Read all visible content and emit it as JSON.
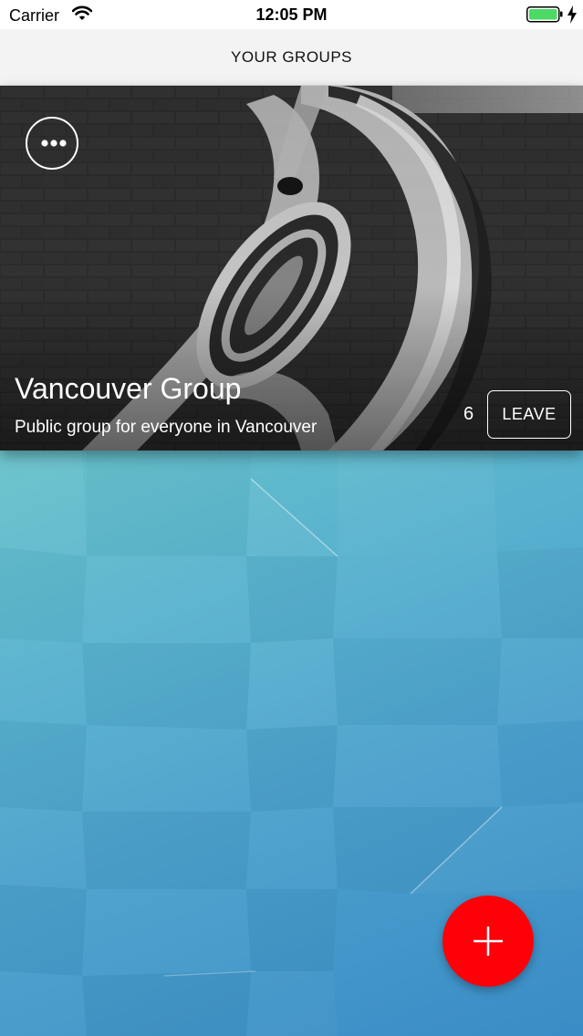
{
  "status_bar": {
    "carrier": "Carrier",
    "time": "12:05 PM",
    "icons": [
      "wifi-icon",
      "battery-icon",
      "charging-icon"
    ]
  },
  "nav": {
    "title": "YOUR GROUPS"
  },
  "groups": [
    {
      "name": "Vancouver Group",
      "description": "Public group for everyone in Vancouver",
      "member_count": "6",
      "leave_label": "LEAVE",
      "more_icon": "more-icon"
    }
  ],
  "fab": {
    "icon": "plus-icon",
    "color": "#fe0008"
  },
  "colors": {
    "background_top": "#8cd8bd",
    "background_bottom": "#3a8cc6",
    "battery": "#4cd964"
  }
}
